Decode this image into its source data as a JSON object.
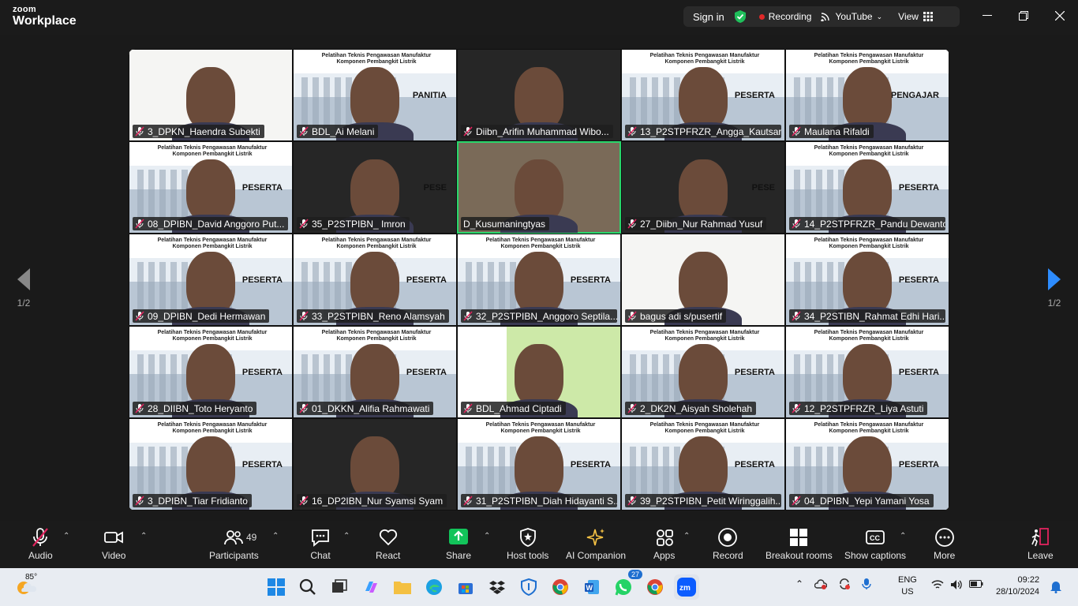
{
  "app": {
    "brand_small": "zoom",
    "brand_large": "Workplace"
  },
  "top": {
    "sign_in": "Sign in",
    "recording": "Recording",
    "youtube": "YouTube",
    "view": "View"
  },
  "nav": {
    "page_left": "1/2",
    "page_right": "1/2"
  },
  "tiles": [
    {
      "name": "3_DPKN_Haendra Subekti",
      "bg": "bg-light",
      "tag": "",
      "active": false
    },
    {
      "name": "BDL_Ai Melani",
      "bg": "bg-peserta",
      "tag": "PANITIA",
      "active": false
    },
    {
      "name": "Diibn_Arifin Muhammad Wibo...",
      "bg": "bg-dark",
      "tag": "",
      "active": false
    },
    {
      "name": "13_P2STPFRZR_Angga_Kautsar",
      "bg": "bg-peserta",
      "tag": "PESERTA",
      "active": false
    },
    {
      "name": "Maulana Rifaldi",
      "bg": "bg-peserta",
      "tag": "PENGAJAR",
      "active": false
    },
    {
      "name": "08_DPIBN_David Anggoro Put...",
      "bg": "bg-peserta",
      "tag": "PESERTA",
      "active": false
    },
    {
      "name": "35_P2STPIBN_ Imron",
      "bg": "bg-dark",
      "tag": "PESE",
      "active": false
    },
    {
      "name": "D_Kusumaningtyas",
      "bg": "bg-room",
      "tag": "",
      "active": true
    },
    {
      "name": "27_Diibn_Nur Rahmad Yusuf",
      "bg": "bg-dark",
      "tag": "PESE",
      "active": false
    },
    {
      "name": "14_P2STPFRZR_Pandu Dewanto",
      "bg": "bg-peserta",
      "tag": "PESERTA",
      "active": false
    },
    {
      "name": "09_DPIBN_Dedi Hermawan",
      "bg": "bg-peserta",
      "tag": "PESERTA",
      "active": false
    },
    {
      "name": "33_P2STPIBN_Reno Alamsyah",
      "bg": "bg-peserta",
      "tag": "PESERTA",
      "active": false
    },
    {
      "name": "32_P2STPIBN_Anggoro Septila...",
      "bg": "bg-peserta",
      "tag": "PESERTA",
      "active": false
    },
    {
      "name": "bagus adi s/pusertif",
      "bg": "bg-light",
      "tag": "",
      "active": false
    },
    {
      "name": "34_P2STIBN_Rahmat Edhi Hari...",
      "bg": "bg-peserta",
      "tag": "PESERTA",
      "active": false
    },
    {
      "name": "28_DIIBN_Toto Heryanto",
      "bg": "bg-peserta",
      "tag": "PESERTA",
      "active": false
    },
    {
      "name": "01_DKKN_Alifia Rahmawati",
      "bg": "bg-peserta",
      "tag": "PESERTA",
      "active": false
    },
    {
      "name": "BDL_Ahmad Ciptadi",
      "bg": "bg-green",
      "tag": "",
      "active": false
    },
    {
      "name": "2_DK2N_Aisyah Sholehah",
      "bg": "bg-peserta",
      "tag": "PESERTA",
      "active": false
    },
    {
      "name": "12_P2STPFRZR_Liya Astuti",
      "bg": "bg-peserta",
      "tag": "PESERTA",
      "active": false
    },
    {
      "name": "3_DPIBN_Tiar Fridianto",
      "bg": "bg-peserta",
      "tag": "PESERTA",
      "active": false
    },
    {
      "name": "16_DP2IBN_Nur Syamsi Syam",
      "bg": "bg-dark",
      "tag": "",
      "active": false
    },
    {
      "name": "31_P2STPIBN_Diah Hidayanti S...",
      "bg": "bg-peserta",
      "tag": "PESERTA",
      "active": false
    },
    {
      "name": "39_P2STPIBN_Petit Wiringgalih...",
      "bg": "bg-peserta",
      "tag": "PESERTA",
      "active": false
    },
    {
      "name": "04_DPIBN_Yepi Yamani Yosa",
      "bg": "bg-peserta",
      "tag": "PESERTA",
      "active": false
    }
  ],
  "slide_header": "Pelatihan Teknis Pengawasan Manufaktur Komponen Pembangkit Listrik",
  "toolbar": {
    "audio": "Audio",
    "video": "Video",
    "participants": "Participants",
    "participants_count": "49",
    "chat": "Chat",
    "react": "React",
    "share": "Share",
    "host_tools": "Host tools",
    "ai_companion": "AI Companion",
    "apps": "Apps",
    "record": "Record",
    "breakout_rooms": "Breakout rooms",
    "show_captions": "Show captions",
    "more": "More",
    "leave": "Leave"
  },
  "taskbar": {
    "temperature": "85°",
    "lang1": "ENG",
    "lang2": "US",
    "time": "09:22",
    "date": "28/10/2024",
    "whatsapp_badge": "27"
  },
  "colors": {
    "active_speaker": "#29d66b",
    "share": "#12c45a",
    "leave": "#e0245e",
    "accent": "#2d8cff"
  }
}
